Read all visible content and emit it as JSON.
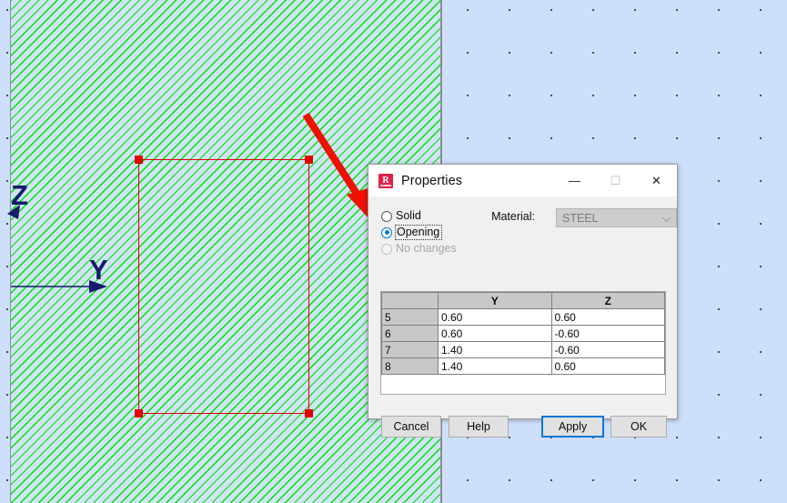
{
  "canvas": {
    "axes": [
      {
        "name": "z-axis",
        "label": "Z"
      },
      {
        "name": "y-axis",
        "label": "Y"
      }
    ],
    "annotation": {
      "name": "red-pointer-arrow",
      "points_to": "opening-radio"
    },
    "selection": {
      "name": "selected-panel-rectangle",
      "handles": 4
    }
  },
  "dialog": {
    "title": "Properties",
    "icon": "robot-structural-analysis-icon",
    "icon_letter": "R",
    "window_buttons": {
      "minimize": "—",
      "maximize": "☐",
      "close": "✕"
    },
    "options": {
      "solid": {
        "label": "Solid",
        "selected": false,
        "enabled": true
      },
      "opening": {
        "label": "Opening",
        "selected": true,
        "enabled": true
      },
      "no_changes": {
        "label": "No changes",
        "selected": false,
        "enabled": false
      }
    },
    "material": {
      "label": "Material:",
      "value": "STEEL",
      "enabled": false
    },
    "table": {
      "columns": [
        "",
        "Y",
        "Z"
      ],
      "rows": [
        {
          "index": "5",
          "y": "0.60",
          "z": "0.60"
        },
        {
          "index": "6",
          "y": "0.60",
          "z": "-0.60"
        },
        {
          "index": "7",
          "y": "1.40",
          "z": "-0.60"
        },
        {
          "index": "8",
          "y": "1.40",
          "z": "0.60"
        }
      ]
    },
    "buttons": {
      "cancel": "Cancel",
      "help": "Help",
      "apply": "Apply",
      "ok": "OK"
    }
  },
  "colors": {
    "hatch_line": "#00e000",
    "hatch_fill": "#cfe4f5",
    "canvas_fill": "#cddffa",
    "selection": "#e30000",
    "annotation_arrow": "#f01000",
    "axis": "#171a6e",
    "accent": "#0078d7"
  }
}
